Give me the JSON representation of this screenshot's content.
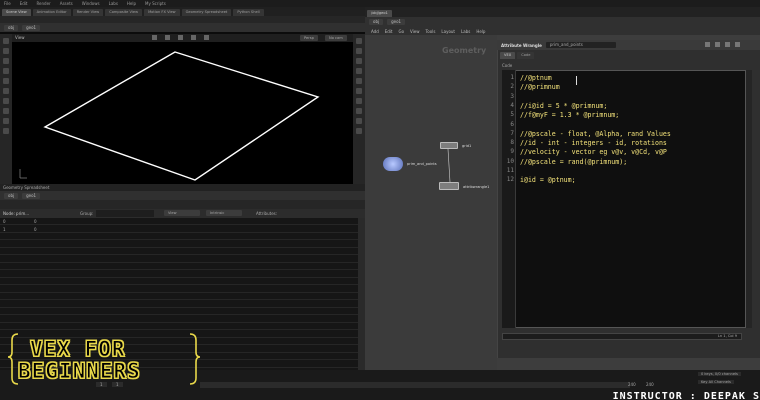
{
  "menubar": {
    "items": [
      "File",
      "Edit",
      "Render",
      "Assets",
      "Windows",
      "Labs",
      "Help",
      "My Scripts"
    ]
  },
  "left_tabs": [
    "Scene View",
    "Animation Editor",
    "Render View",
    "Composite View",
    "Motion FX View",
    "Geometry Spreadsheet",
    "Python Shell"
  ],
  "network_tabs": [
    "/obj/geo1"
  ],
  "left_path": {
    "root": "obj",
    "node": "geo1"
  },
  "viewport": {
    "label": "View",
    "camera": "Persp",
    "cam_menu": "No cam"
  },
  "network": {
    "path_root": "obj",
    "path_node": "geo1",
    "menu": [
      "Add",
      "Edit",
      "Go",
      "View",
      "Tools",
      "Layout",
      "Labs",
      "Help"
    ],
    "watermark": "Geometry",
    "nodes": [
      {
        "label": "prim_and_points",
        "type": "grid"
      },
      {
        "label": "grid1",
        "type": "grid"
      },
      {
        "label": "attribwrangle1",
        "type": "wrangle"
      }
    ]
  },
  "params": {
    "type": "Attribute Wrangle",
    "name": "prim_and_points",
    "tabs": [
      "VEX",
      "Code"
    ],
    "section": "Code",
    "status": "Ln 1, Col 9"
  },
  "code_lines": [
    {
      "num": "1",
      "text": "//@ptnum"
    },
    {
      "num": "2",
      "text": "//@primnum"
    },
    {
      "num": "3",
      "text": ""
    },
    {
      "num": "4",
      "text": "//i@id = 5 * @primnum;"
    },
    {
      "num": "5",
      "text": "//f@myF = 1.3 * @primnum;"
    },
    {
      "num": "6",
      "text": ""
    },
    {
      "num": "7",
      "text": "//@pscale - float, @Alpha, rand Values"
    },
    {
      "num": "8",
      "text": "//id - int - integers - id, rotations"
    },
    {
      "num": "9",
      "text": "//velocity - vector eg v@v, v@Cd, v@P"
    },
    {
      "num": "10",
      "text": "//@pscale = rand(@primnum);"
    },
    {
      "num": "11",
      "text": ""
    },
    {
      "num": "12",
      "text": "i@id = @ptnum;"
    }
  ],
  "spreadsheet": {
    "title": "Geometry Spreadsheet",
    "path_root": "obj",
    "path_node": "geo1",
    "node_label": "Node: prim...",
    "group_label": "Group:",
    "view_label": "View",
    "intrinsic_label": "Intrinsic",
    "attributes_label": "Attributes:",
    "rows": [
      {
        "index": "0",
        "value": "0"
      },
      {
        "index": "1",
        "value": "0"
      }
    ]
  },
  "timeline": {
    "start": "1",
    "current": "1",
    "end": "240",
    "end2": "240",
    "keys": "0 keys, 0/0 channels",
    "channels": "Key All Channels"
  },
  "overlay": {
    "title_line1": "VEX FOR",
    "title_line2": "BEGINNERS",
    "instructor": "INSTRUCTOR : DEEPAK S"
  },
  "colors": {
    "code_text": "#f3e27a",
    "title_stroke": "#e8d84a",
    "bg": "#0c0c0c"
  }
}
